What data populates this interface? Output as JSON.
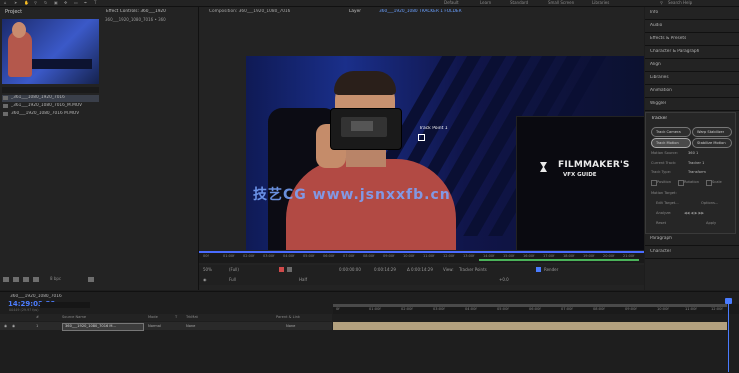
{
  "toolbar": {
    "items": [
      "Default",
      "Learn",
      "Standard",
      "Small Screen",
      "Libraries"
    ],
    "search_label": "Search Help"
  },
  "project": {
    "tab": "Project",
    "files": [
      {
        "name": "_361___1080_1920_7016",
        "selected": true
      },
      {
        "name": "_361___1920_1080_7016_M.MOV",
        "selected": false
      },
      {
        "name": "360___1920_1080_7016 M.MOV",
        "selected": false
      }
    ],
    "bpc": "8 bpc"
  },
  "effects": {
    "tab": "Effect Controls: 360___1920",
    "subtitle": "360___1920_1080_7016 • 360"
  },
  "composition": {
    "tab1": "Composition: 360___1920_1080_7016",
    "tab2": "Layer",
    "tab2_sub": "360___1920_1080 TRACKER 1 FOLDER",
    "track_point_label": "Track Point 1",
    "monitor_logo": "FILMMAKER'S",
    "monitor_sub": "VFX GUIDE",
    "watermark": "技艺CG  www.jsnxxfb.cn",
    "ruler_ticks": [
      "00f",
      "01:00f",
      "02:00f",
      "03:00f",
      "04:00f",
      "05:00f",
      "06:00f",
      "07:00f",
      "08:00f",
      "09:00f",
      "10:00f",
      "11:00f",
      "12:00f",
      "13:00f",
      "14:00f",
      "15:00f",
      "16:00f",
      "17:00f",
      "18:00f",
      "19:00f",
      "20:00f",
      "21:00f"
    ],
    "controls": {
      "zoom": "(Full)",
      "timecode_in": "0:00:00:00",
      "timecode_out": "0:00:14:29",
      "timecode_dur": "Δ 0:00:14:29",
      "view_label": "View:",
      "view_value": "Tracker Points",
      "render_label": "Render",
      "resolution": "Full",
      "magnification": "50%",
      "color_label": "+0.0",
      "exposure": "Half"
    }
  },
  "right_panels": {
    "items": [
      "Info",
      "Audio",
      "Effects & Presets",
      "Character & Paragraph",
      "Align",
      "Libraries",
      "Animation",
      "Wiggler"
    ],
    "tracker": {
      "title": "Tracker",
      "buttons": [
        {
          "label": "Track Camera",
          "active": false
        },
        {
          "label": "Warp Stabilizer",
          "active": false
        },
        {
          "label": "Track Motion",
          "active": true
        },
        {
          "label": "Stabilize Motion",
          "active": false
        }
      ],
      "motion_source_label": "Motion Source:",
      "motion_source_value": "360 1",
      "current_track_label": "Current Track:",
      "current_track_value": "Tracker 1",
      "track_type_label": "Track Type:",
      "track_type_value": "Transform",
      "checks": [
        "Position",
        "Rotation",
        "Scale"
      ],
      "motion_target_label": "Motion Target:",
      "edit_target": "Edit Target...",
      "options": "Options...",
      "analyze_label": "Analyze:",
      "reset": "Reset",
      "apply": "Apply"
    },
    "bottom_items": [
      "Paragraph",
      "Character"
    ]
  },
  "timeline": {
    "tab": "360___1920_1080_7016",
    "time": "14:29:03:29",
    "fps": "00449 (29.97 fps)",
    "headers": [
      "#",
      "Source Name",
      "Mode",
      "T",
      "TrkMat",
      "Parent & Link"
    ],
    "layer": {
      "index": "1",
      "name": "360___1920_1080_7016 M...",
      "mode": "Normal",
      "trkmat": "None",
      "parent": "None"
    },
    "ticks": [
      "0f",
      "01:00f",
      "02:00f",
      "03:00f",
      "04:00f",
      "05:00f",
      "06:00f",
      "07:00f",
      "08:00f",
      "09:00f",
      "10:00f",
      "11:00f",
      "12:00f"
    ]
  },
  "colors": {
    "accent_blue": "#4a7cff",
    "work_area_green": "#4bb35a",
    "layer_bar": "#b3a17f"
  }
}
